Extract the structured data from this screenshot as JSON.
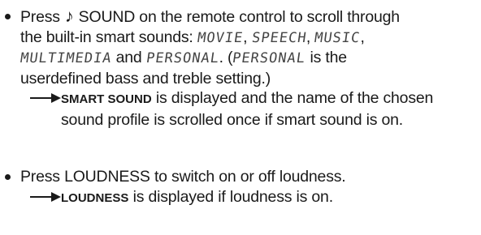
{
  "bullets": [
    {
      "lines": [
        [
          "Press",
          "SOUND on the remote control to scroll through"
        ],
        [
          "the built-in smart sounds:",
          "MOVIE",
          ",",
          "SPEECH",
          ",",
          "MUSIC",
          ","
        ],
        [
          "MULTIMEDIA",
          "and",
          "PERSONAL",
          ". (",
          "PERSONAL",
          "is the"
        ],
        [
          "userdefined bass and treble setting.)"
        ]
      ],
      "result": {
        "label": "SMART SOUND",
        "text_1": "is displayed and the name of the chosen",
        "text_2": "sound profile is scrolled once if smart sound is on."
      }
    },
    {
      "lines": [
        [
          "Press LOUDNESS to switch on or off loudness."
        ]
      ],
      "result": {
        "label": "LOUDNESS",
        "text_1": "is displayed if loudness is on."
      }
    }
  ],
  "icons": {
    "bullet": "bullet-dot-icon",
    "note": "music-note-icon",
    "arrow": "right-arrow-icon"
  }
}
